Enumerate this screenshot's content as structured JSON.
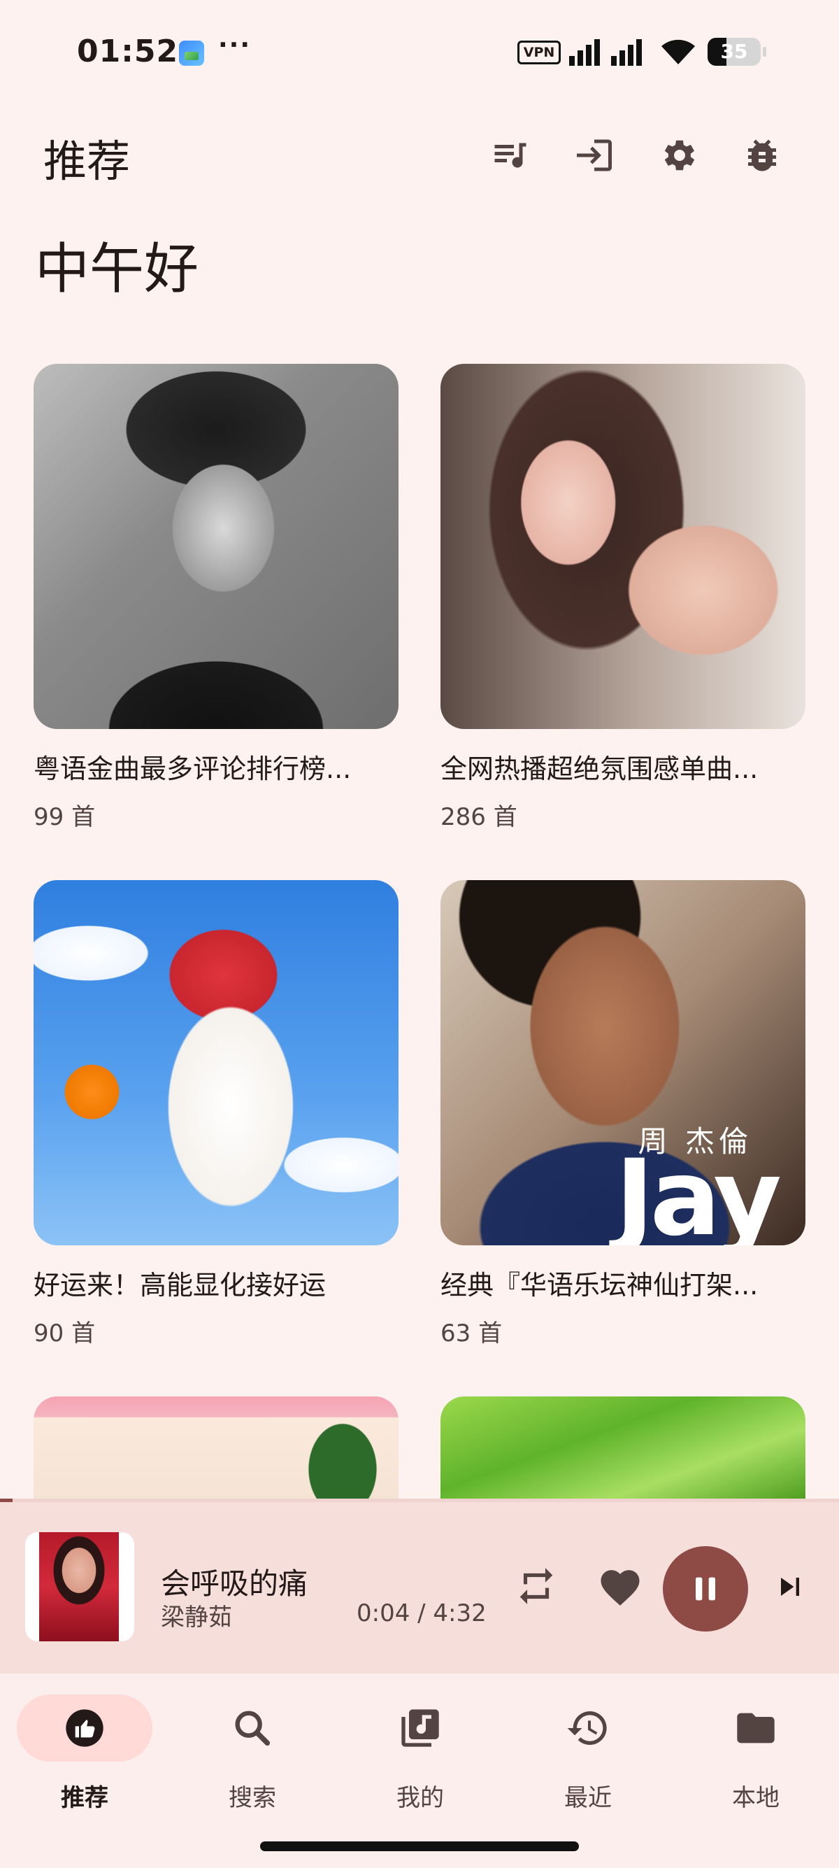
{
  "status_bar": {
    "time": "01:52",
    "more": "···",
    "vpn": "VPN",
    "battery": "35",
    "battery_level": 0.35
  },
  "header": {
    "title": "推荐",
    "actions": [
      {
        "icon": "queue-music-icon"
      },
      {
        "icon": "login-icon"
      },
      {
        "icon": "settings-gear-icon"
      },
      {
        "icon": "bug-report-icon"
      }
    ]
  },
  "greeting": "中午好",
  "playlists": [
    {
      "title": "粤语金曲最多评论排行榜...",
      "count": "99 首"
    },
    {
      "title": "全网热播超绝氛围感单曲...",
      "count": "286 首"
    },
    {
      "title": "好运来！高能显化接好运",
      "count": "90 首"
    },
    {
      "title": "经典『华语乐坛神仙打架...",
      "count": "63 首"
    }
  ],
  "jay_cover": {
    "name": "周 杰倫",
    "logo": "Jay"
  },
  "now_playing": {
    "title": "会呼吸的痛",
    "artist": "梁静茹",
    "time": "0:04 / 4:32",
    "progress": 0.015,
    "liked": true,
    "playing": true
  },
  "bottom_nav": [
    {
      "label": "推荐",
      "icon": "thumb-up-icon",
      "active": true
    },
    {
      "label": "搜索",
      "icon": "search-icon",
      "active": false
    },
    {
      "label": "我的",
      "icon": "library-music-icon",
      "active": false
    },
    {
      "label": "最近",
      "icon": "history-icon",
      "active": false
    },
    {
      "label": "本地",
      "icon": "folder-icon",
      "active": false
    }
  ],
  "colors": {
    "background": "#fdf2f0",
    "accent": "#8e4a45",
    "nav_active": "#ffdad6",
    "player_bar": "#f6dedb"
  }
}
